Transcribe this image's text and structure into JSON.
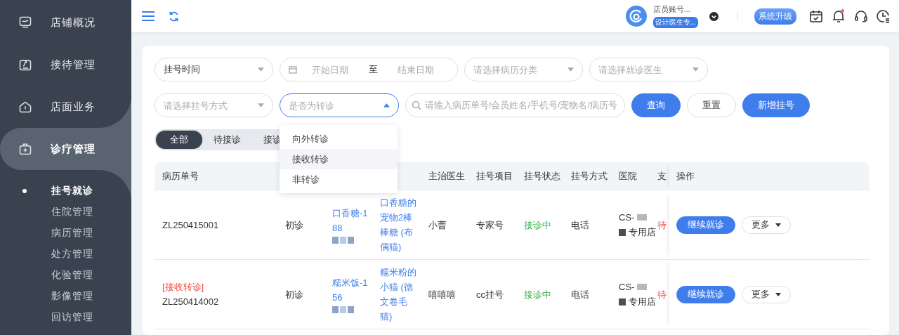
{
  "sidebar": {
    "items": [
      {
        "label": "店铺概况",
        "selected": false
      },
      {
        "label": "接待管理",
        "selected": false
      },
      {
        "label": "店面业务",
        "selected": false
      },
      {
        "label": "诊疗管理",
        "selected": true,
        "children": [
          {
            "label": "挂号就诊",
            "selected": true
          },
          {
            "label": "住院管理",
            "selected": false
          },
          {
            "label": "病历管理",
            "selected": false
          },
          {
            "label": "处方管理",
            "selected": false
          },
          {
            "label": "化验管理",
            "selected": false
          },
          {
            "label": "影像管理",
            "selected": false
          },
          {
            "label": "回访管理",
            "selected": false
          }
        ]
      }
    ]
  },
  "header": {
    "user_name": "店员账号...",
    "user_role": "设计医生专...",
    "upgrade_button": "系统升级",
    "notification_dot": true
  },
  "filters": [
    [
      {
        "kind": "select",
        "value": "挂号时间",
        "expanded": false
      },
      {
        "kind": "date_range",
        "start_placeholder": "开始日期",
        "separator": "至",
        "end_placeholder": "结束日期"
      },
      {
        "kind": "select",
        "placeholder": "请选择病历分类",
        "expanded": false
      },
      {
        "kind": "select",
        "placeholder": "请选择就诊医生",
        "expanded": false
      }
    ],
    [
      {
        "kind": "select",
        "placeholder": "请选择挂号方式",
        "expanded": false
      },
      {
        "kind": "select",
        "placeholder": "是否为转诊",
        "expanded": true,
        "options": [
          {
            "label": "向外转诊",
            "highlighted": false
          },
          {
            "label": "接收转诊",
            "highlighted": true
          },
          {
            "label": "非转诊",
            "highlighted": false
          }
        ]
      },
      {
        "kind": "search",
        "placeholder": "请输入病历单号/会员姓名/手机号/宠物名/病历号"
      },
      {
        "kind": "button",
        "label": "查询",
        "primary": true
      },
      {
        "kind": "button",
        "label": "重置",
        "primary": false
      },
      {
        "kind": "button",
        "label": "新增挂号",
        "primary": true
      }
    ]
  ],
  "tabs": [
    {
      "label": "全部",
      "selected": true
    },
    {
      "label": "待接诊",
      "selected": false
    },
    {
      "label": "接诊",
      "selected": false
    }
  ],
  "table": {
    "columns": [
      {
        "label": "病历单号"
      },
      {},
      {},
      {},
      {
        "label": "主治医生"
      },
      {
        "label": "挂号项目"
      },
      {
        "label": "挂号状态"
      },
      {
        "label": "挂号方式"
      },
      {
        "label": "医院"
      },
      {
        "label": "支"
      },
      {
        "label": "操作"
      }
    ],
    "rows": [
      {
        "record_no": "ZL250415001",
        "visit_type": "初诊",
        "owner": "口香糖-188",
        "pet": "口香糖的宠物2棒棒糖 (布偶猫)",
        "doctor": "小曹",
        "item": "专家号",
        "status": {
          "text": "接诊中",
          "kind": "in_progress"
        },
        "method": "电话",
        "hospital_prefix": "CS-",
        "hospital_suffix": "专用店",
        "payment": {
          "text": "待",
          "kind": "pending"
        },
        "primary_action": "继续就诊",
        "more_action": "更多"
      },
      {
        "record_tag": "[接收转诊]",
        "record_no": "ZL250414002",
        "visit_type": "初诊",
        "owner": "糯米饭-156",
        "pet": "糯米粉的小猫 (德文卷毛猫)",
        "doctor": "嘻嘻嘻",
        "item": "cc挂号",
        "status": {
          "text": "接诊中",
          "kind": "in_progress"
        },
        "method": "电话",
        "hospital_prefix": "CS-",
        "hospital_suffix": "专用店",
        "payment": {
          "text": "待",
          "kind": "pending"
        },
        "primary_action": "继续就诊",
        "more_action": "更多"
      }
    ]
  }
}
